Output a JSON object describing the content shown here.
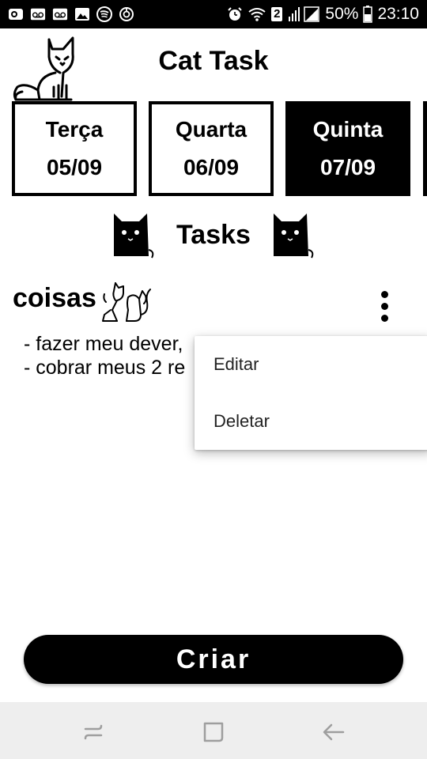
{
  "status_bar": {
    "battery": "50%",
    "time": "23:10",
    "sim_badge": "2",
    "icons": [
      "camera-notification-icon",
      "voicemail-icon",
      "voicemail-icon",
      "image-icon",
      "spotify-icon",
      "sync-icon",
      "alarm-icon",
      "wifi-icon",
      "signal-icon",
      "battery-icon"
    ]
  },
  "header": {
    "title": "Cat Task",
    "logo_icon": "sitting-cat-icon"
  },
  "days": [
    {
      "name": "Terça",
      "date": "05/09",
      "selected": false
    },
    {
      "name": "Quarta",
      "date": "06/09",
      "selected": false
    },
    {
      "name": "Quinta",
      "date": "07/09",
      "selected": true
    }
  ],
  "tasks_section": {
    "label": "Tasks"
  },
  "task": {
    "title": "coisas",
    "lines": [
      "- fazer meu dever,",
      "- cobrar meus 2 re"
    ]
  },
  "menu": {
    "items": [
      "Editar",
      "Deletar"
    ]
  },
  "create_button": {
    "label": "Criar"
  },
  "nav": {
    "icons": [
      "recent-apps-icon",
      "home-icon",
      "back-icon"
    ]
  },
  "colors": {
    "primary": "#000000",
    "background": "#ffffff",
    "navbar": "#eeeeee",
    "nav_icon": "#9e9e9e"
  }
}
